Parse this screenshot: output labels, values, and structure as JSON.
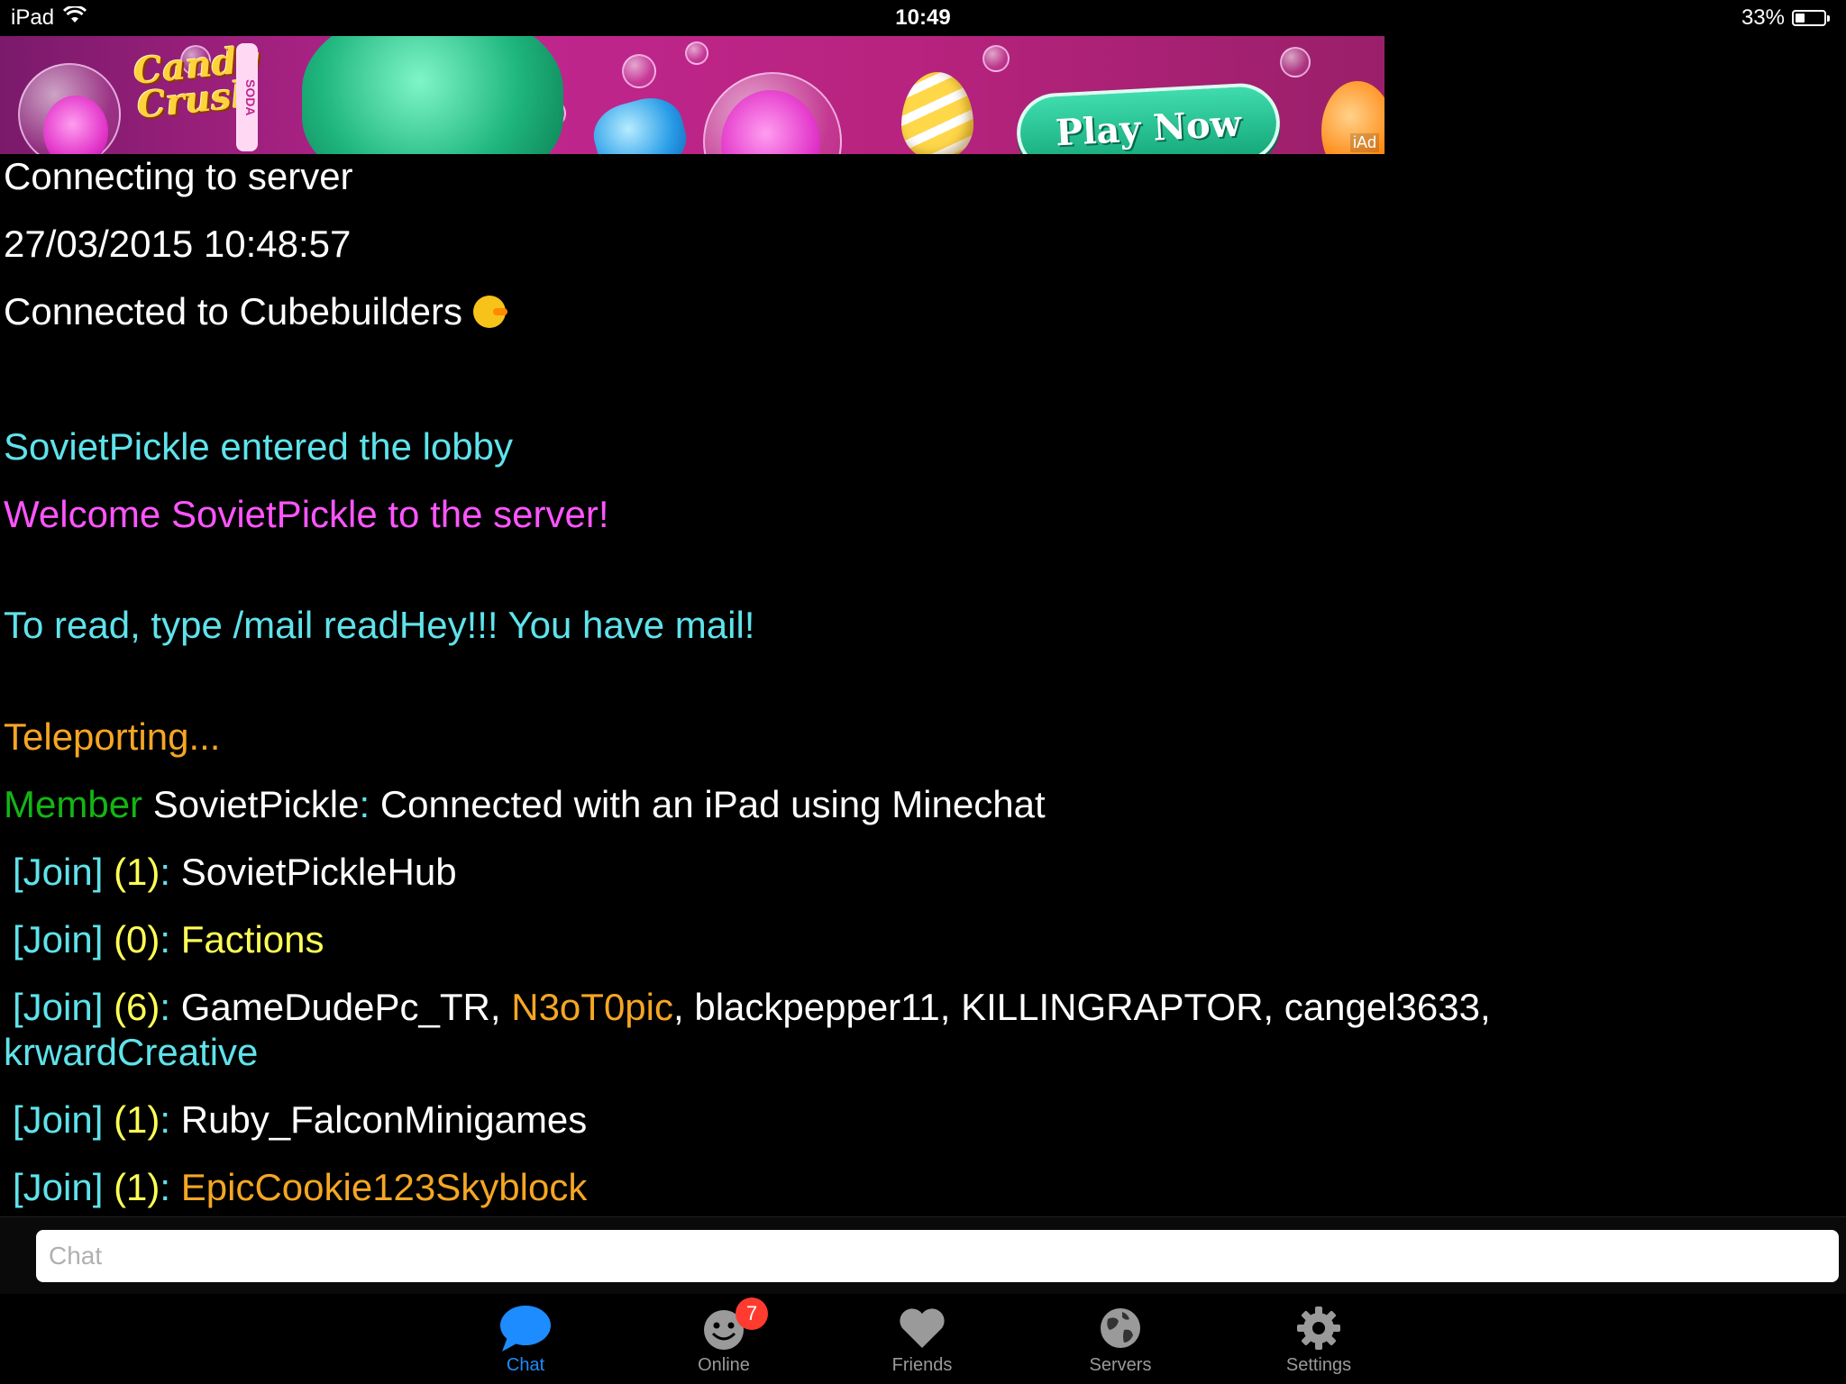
{
  "status_bar": {
    "device": "iPad",
    "time": "10:49",
    "battery_percent": "33%",
    "battery_level": 0.33,
    "icons": [
      "wifi-icon",
      "battery-icon"
    ]
  },
  "ad": {
    "logo_line1": "Candy",
    "logo_line2": "Crush",
    "soda_text": "SODA",
    "cta": "Play Now",
    "badge": "iAd"
  },
  "chat_log": {
    "connecting": "Connecting to server",
    "timestamp": "27/03/2015 10:48:57",
    "connected": "Connected to Cubebuilders",
    "entered": "SovietPickle entered the lobby",
    "welcome": "Welcome SovietPickle to the server!",
    "mail": "To read, type /mail readHey!!!  You have mail!",
    "teleporting": "Teleporting...",
    "member_rank": "Member",
    "member_name": " SovietPickle",
    "member_sep": ":",
    "member_msg": " Connected with an iPad using Minechat",
    "join_rows": [
      {
        "tag": "[Join]",
        "count": "(1)",
        "sep": ":",
        "names": " SovietPickleHub"
      },
      {
        "tag": "[Join]",
        "count": "(0)",
        "sep": ":",
        "names": " Factions"
      },
      {
        "tag": "[Join]",
        "count": "(6)",
        "sep": ":",
        "name1": " GameDudePc_TR, ",
        "name2": "N3oT0pic",
        "name3": ", blackpepper11, KILLINGRAPTOR, cangel3633,",
        "name4": "krwardCreative"
      },
      {
        "tag": "[Join]",
        "count": "(1)",
        "sep": ":",
        "names": " Ruby_FalconMinigames"
      },
      {
        "tag": "[Join]",
        "count": "(1)",
        "sep": ":",
        "names": " EpicCookie123Skyblock"
      }
    ]
  },
  "input": {
    "placeholder": "Chat",
    "value": ""
  },
  "tabs": [
    {
      "label": "Chat",
      "icon": "chat-bubble-icon",
      "active": true
    },
    {
      "label": "Online",
      "icon": "smiley-icon",
      "badge": "7"
    },
    {
      "label": "Friends",
      "icon": "heart-icon"
    },
    {
      "label": "Servers",
      "icon": "globe-icon"
    },
    {
      "label": "Settings",
      "icon": "gear-icon"
    }
  ],
  "colors": {
    "cyan": "#5fe3eb",
    "magenta": "#ff55ff",
    "orange": "#f5a623",
    "green": "#14b514",
    "yellow": "#ffff55",
    "tab_active": "#1c8cff",
    "badge": "#ff3b30"
  }
}
